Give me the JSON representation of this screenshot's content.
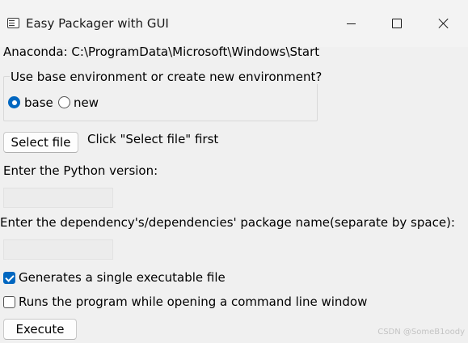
{
  "window": {
    "title": "Easy Packager with GUI",
    "controls": {
      "minimize": "minimize-icon",
      "maximize": "maximize-icon",
      "close": "close-icon"
    }
  },
  "anaconda_path": "Anaconda: C:\\ProgramData\\Microsoft\\Windows\\Start",
  "environment": {
    "group_title": "Use base environment or create new environment?",
    "options": [
      {
        "label": "base",
        "selected": true
      },
      {
        "label": "new",
        "selected": false
      }
    ]
  },
  "file": {
    "button_label": "Select file",
    "hint": "Click \"Select file\" first"
  },
  "python_version": {
    "label": "Enter the Python version:",
    "value": ""
  },
  "dependencies": {
    "label": "Enter the dependency's/dependencies' package name(separate by space):",
    "value": ""
  },
  "options": {
    "single_file": {
      "label": "Generates a single executable file",
      "checked": true
    },
    "console": {
      "label": "Runs the program while opening a command line window",
      "checked": false
    }
  },
  "execute_label": "Execute",
  "watermark": "CSDN @SomeB1oody",
  "colors": {
    "accent": "#0067c0",
    "background": "#f0f0f0"
  }
}
